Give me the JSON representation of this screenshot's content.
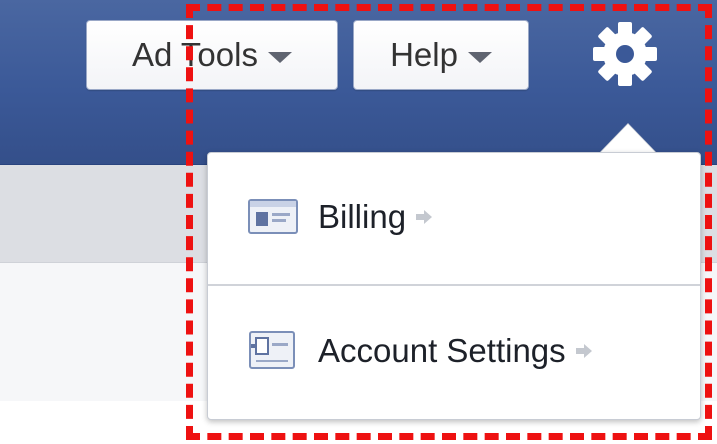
{
  "topbar": {
    "ad_tools_label": "Ad Tools",
    "help_label": "Help",
    "gear_icon": "gear-icon"
  },
  "dropdown": {
    "items": [
      {
        "label": "Billing",
        "icon": "billing-card-icon",
        "arrow": "arrow-right-icon"
      },
      {
        "label": "Account Settings",
        "icon": "account-settings-icon",
        "arrow": "arrow-right-icon"
      }
    ]
  },
  "colors": {
    "topbar_blue": "#3b5998",
    "highlight_red": "#ee1111",
    "text_dark": "#1d2129",
    "icon_blue": "#7b8fb8"
  }
}
